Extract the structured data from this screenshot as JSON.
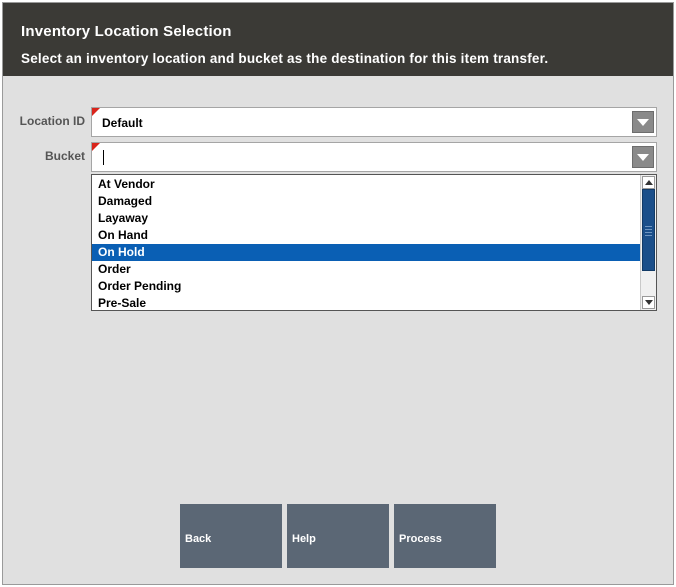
{
  "header": {
    "title": "Inventory Location Selection",
    "subtitle": "Select an inventory location and bucket as the destination for this item transfer."
  },
  "form": {
    "location": {
      "label": "Location ID",
      "value": "Default"
    },
    "bucket": {
      "label": "Bucket",
      "value": ""
    }
  },
  "bucket_options": [
    {
      "label": "At Vendor",
      "selected": false
    },
    {
      "label": "Damaged",
      "selected": false
    },
    {
      "label": "Layaway",
      "selected": false
    },
    {
      "label": "On Hand",
      "selected": false
    },
    {
      "label": "On Hold",
      "selected": true
    },
    {
      "label": "Order",
      "selected": false
    },
    {
      "label": "Order Pending",
      "selected": false
    },
    {
      "label": "Pre-Sale",
      "selected": false
    }
  ],
  "buttons": {
    "back": "Back",
    "help": "Help",
    "process": "Process"
  },
  "colors": {
    "header_bg": "#3b3a36",
    "panel_bg": "#e0e0e0",
    "required_marker": "#d9251c",
    "selection": "#0a5fb4",
    "button_bg": "#5b6775"
  }
}
